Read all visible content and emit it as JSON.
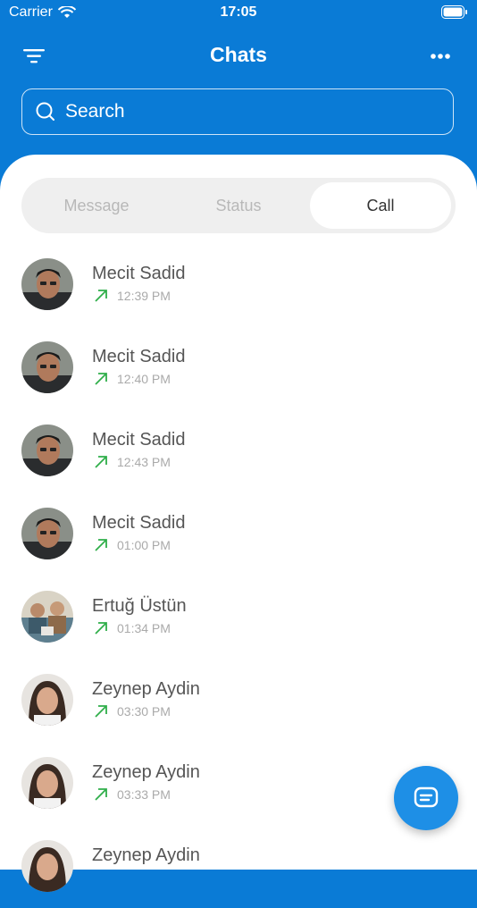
{
  "status_bar": {
    "carrier": "Carrier",
    "time": "17:05"
  },
  "header": {
    "title": "Chats"
  },
  "search": {
    "placeholder": "Search"
  },
  "tabs": [
    {
      "label": "Message",
      "active": false
    },
    {
      "label": "Status",
      "active": false
    },
    {
      "label": "Call",
      "active": true
    }
  ],
  "calls": [
    {
      "name": "Mecit Sadid",
      "time": "12:39 PM",
      "direction": "outgoing",
      "avatar": "man-dark-hair"
    },
    {
      "name": "Mecit Sadid",
      "time": "12:40 PM",
      "direction": "outgoing",
      "avatar": "man-dark-hair"
    },
    {
      "name": "Mecit Sadid",
      "time": "12:43 PM",
      "direction": "outgoing",
      "avatar": "man-dark-hair"
    },
    {
      "name": "Mecit Sadid",
      "time": "01:00 PM",
      "direction": "outgoing",
      "avatar": "man-dark-hair"
    },
    {
      "name": "Ertuğ Üstün",
      "time": "01:34 PM",
      "direction": "outgoing",
      "avatar": "group-photo"
    },
    {
      "name": "Zeynep Aydin",
      "time": "03:30 PM",
      "direction": "outgoing",
      "avatar": "woman-dark-hair"
    },
    {
      "name": "Zeynep Aydin",
      "time": "03:33 PM",
      "direction": "outgoing",
      "avatar": "woman-dark-hair"
    },
    {
      "name": "Zeynep Aydin",
      "time": "",
      "direction": "outgoing",
      "avatar": "woman-dark-hair"
    }
  ],
  "colors": {
    "primary": "#0a7bd6",
    "call_arrow": "#2fae4a",
    "fab": "#1e8fe6"
  }
}
